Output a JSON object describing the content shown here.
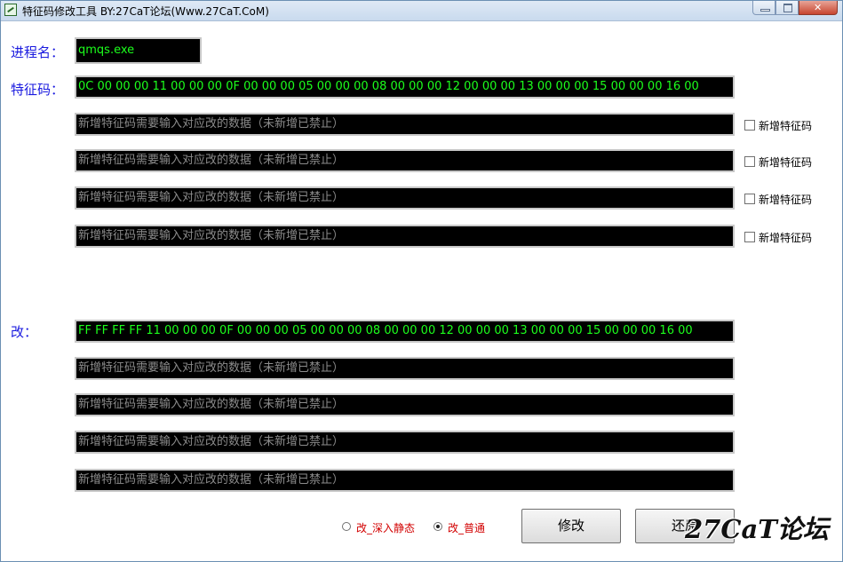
{
  "window": {
    "title": "特征码修改工具 BY:27CaT论坛(Www.27CaT.CoM)"
  },
  "process": {
    "label": "进程名：",
    "value": "qmqs.exe"
  },
  "signature": {
    "label": "特征码：",
    "main_value": "0C 00 00 00 11 00 00 00 0F 00 00 00 05 00 00 00 08 00 00 00 12 00 00 00 13 00 00 00 15 00 00 00 16 00",
    "extra_fields": [
      {
        "placeholder": "新增特征码需要输入对应改的数据（未新增已禁止）",
        "checkbox_label": "新增特征码"
      },
      {
        "placeholder": "新增特征码需要输入对应改的数据（未新增已禁止）",
        "checkbox_label": "新增特征码"
      },
      {
        "placeholder": "新增特征码需要输入对应改的数据（未新增已禁止）",
        "checkbox_label": "新增特征码"
      },
      {
        "placeholder": "新增特征码需要输入对应改的数据（未新增已禁止）",
        "checkbox_label": "新增特征码"
      }
    ]
  },
  "modify": {
    "label": "改：",
    "main_value": "FF FF FF FF 11 00 00 00 0F 00 00 00 05 00 00 00 08 00 00 00 12 00 00 00 13 00 00 00 15 00 00 00 16 00",
    "extra_fields": [
      {
        "placeholder": "新增特征码需要输入对应改的数据（未新增已禁止）"
      },
      {
        "placeholder": "新增特征码需要输入对应改的数据（未新增已禁止）"
      },
      {
        "placeholder": "新增特征码需要输入对应改的数据（未新增已禁止）"
      },
      {
        "placeholder": "新增特征码需要输入对应改的数据（未新增已禁止）"
      }
    ]
  },
  "options": {
    "radio_deep_static": "改_深入静态",
    "radio_normal": "改_普通",
    "selected": "normal"
  },
  "buttons": {
    "modify": "修改",
    "restore": "还原"
  },
  "watermark": "27CaT论坛",
  "icons": {
    "app": "app-icon",
    "minimize": "minimize-icon",
    "maximize": "maximize-icon",
    "close": "close-icon"
  }
}
